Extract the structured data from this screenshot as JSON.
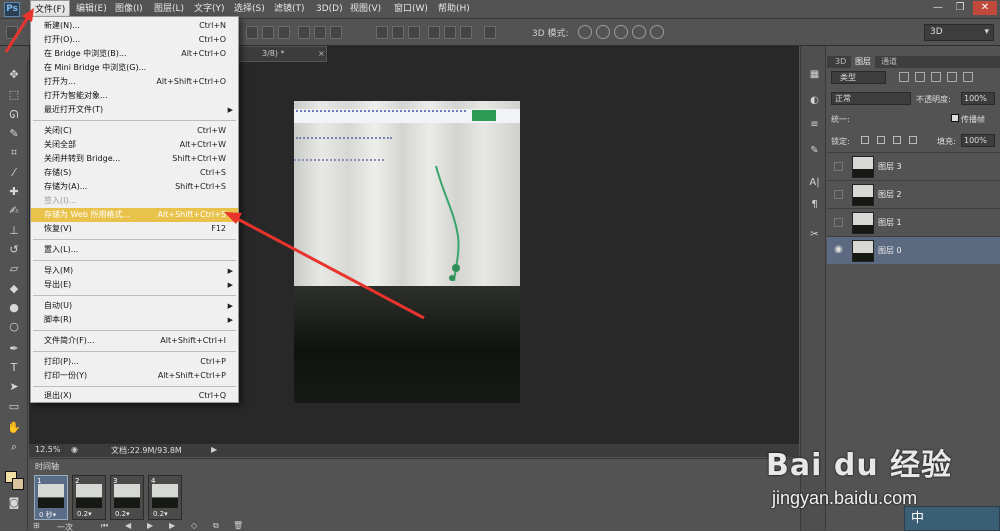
{
  "app": {
    "logo": "Ps",
    "menus": [
      "文件(F)",
      "编辑(E)",
      "图像(I)",
      "图层(L)",
      "文字(Y)",
      "选择(S)",
      "滤镜(T)",
      "3D(D)",
      "视图(V)",
      "窗口(W)",
      "帮助(H)"
    ],
    "active_menu": "文件(F)"
  },
  "options_bar": {
    "mode_3d_label": "3D 模式:",
    "workspace": "3D"
  },
  "document": {
    "tab_title": "3/8) *",
    "zoom": "12.5%",
    "doc_size": "文档:22.9M/93.8M"
  },
  "file_menu": {
    "items": [
      {
        "label": "新建(N)...",
        "shortcut": "Ctrl+N"
      },
      {
        "label": "打开(O)...",
        "shortcut": "Ctrl+O"
      },
      {
        "label": "在 Bridge 中浏览(B)...",
        "shortcut": "Alt+Ctrl+O"
      },
      {
        "label": "在 Mini Bridge 中浏览(G)...",
        "shortcut": ""
      },
      {
        "label": "打开为...",
        "shortcut": "Alt+Shift+Ctrl+O"
      },
      {
        "label": "打开为智能对象...",
        "shortcut": ""
      },
      {
        "label": "最近打开文件(T)",
        "shortcut": "",
        "submenu": true
      },
      {
        "label": "关闭(C)",
        "shortcut": "Ctrl+W"
      },
      {
        "label": "关闭全部",
        "shortcut": "Alt+Ctrl+W"
      },
      {
        "label": "关闭并转到 Bridge...",
        "shortcut": "Shift+Ctrl+W"
      },
      {
        "label": "存储(S)",
        "shortcut": "Ctrl+S"
      },
      {
        "label": "存储为(A)...",
        "shortcut": "Shift+Ctrl+S"
      },
      {
        "label": "签入(I)...",
        "shortcut": "",
        "disabled": true
      },
      {
        "label": "存储为 Web 所用格式...",
        "shortcut": "Alt+Shift+Ctrl+S",
        "highlight": true
      },
      {
        "label": "恢复(V)",
        "shortcut": "F12"
      },
      {
        "label": "置入(L)...",
        "shortcut": ""
      },
      {
        "label": "导入(M)",
        "shortcut": "",
        "submenu": true
      },
      {
        "label": "导出(E)",
        "shortcut": "",
        "submenu": true
      },
      {
        "label": "自动(U)",
        "shortcut": "",
        "submenu": true
      },
      {
        "label": "脚本(R)",
        "shortcut": "",
        "submenu": true
      },
      {
        "label": "文件简介(F)...",
        "shortcut": "Alt+Shift+Ctrl+I"
      },
      {
        "label": "打印(P)...",
        "shortcut": "Ctrl+P"
      },
      {
        "label": "打印一份(Y)",
        "shortcut": "Alt+Shift+Ctrl+P"
      },
      {
        "label": "退出(X)",
        "shortcut": "Ctrl+Q"
      }
    ]
  },
  "timeline": {
    "title": "时间轴",
    "frames": [
      {
        "no": "1",
        "delay": "0 秒▾"
      },
      {
        "no": "2",
        "delay": "0.2▾"
      },
      {
        "no": "3",
        "delay": "0.2▾"
      },
      {
        "no": "4",
        "delay": "0.2▾"
      }
    ],
    "loop": "一次"
  },
  "layers_panel": {
    "tabs": [
      "3D",
      "图层",
      "通道"
    ],
    "active_tab": "图层",
    "kind_filter": "类型",
    "blend_mode": "正常",
    "opacity_label": "不透明度:",
    "opacity": "100%",
    "unify_label": "统一:",
    "propagate_label": "传播帧",
    "lock_label": "锁定:",
    "fill_label": "填充:",
    "fill": "100%",
    "layers": [
      {
        "name": "图层 3",
        "visible": false,
        "selected": false
      },
      {
        "name": "图层 2",
        "visible": false,
        "selected": false
      },
      {
        "name": "图层 1",
        "visible": false,
        "selected": false
      },
      {
        "name": "图层 0",
        "visible": true,
        "selected": true
      }
    ]
  },
  "watermark": {
    "logo": "Bai du 经验",
    "url": "jingyan.baidu.com",
    "corner": "中"
  }
}
